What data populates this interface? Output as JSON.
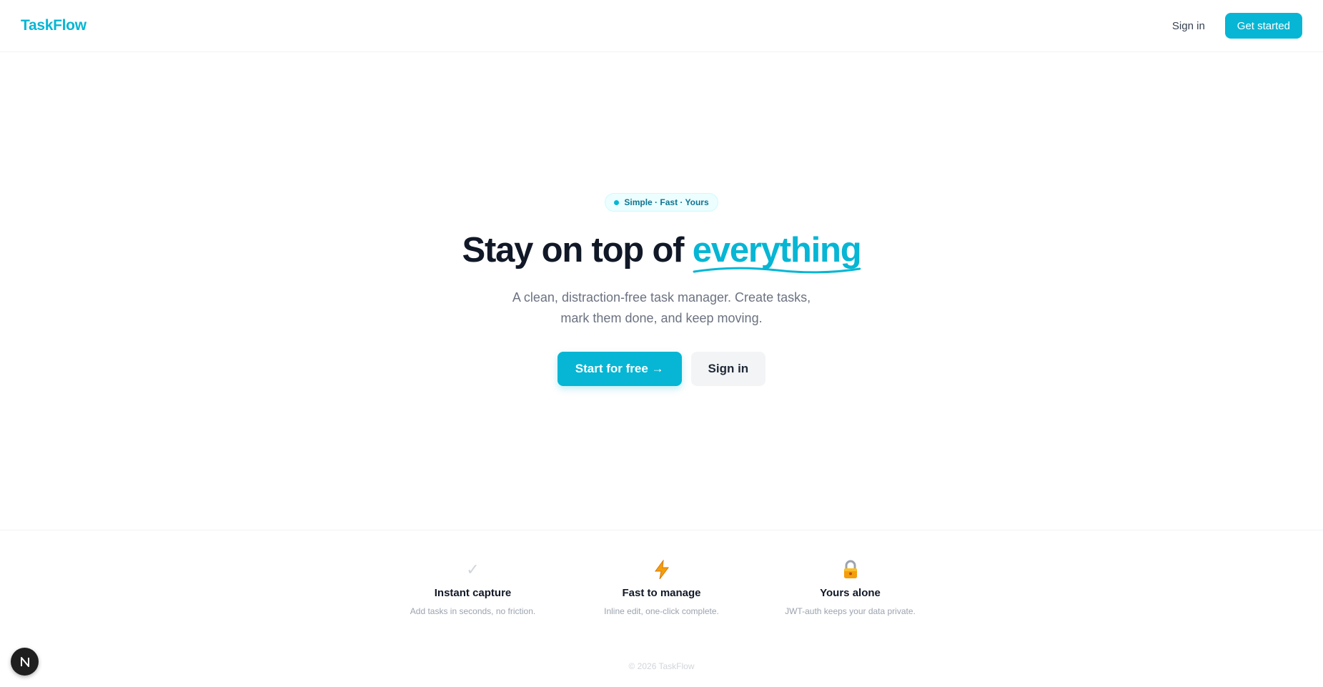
{
  "header": {
    "logo": "TaskFlow",
    "signin_label": "Sign in",
    "cta_label": "Get started"
  },
  "hero": {
    "badge": "Simple · Fast · Yours",
    "headline_prefix": "Stay on top of ",
    "headline_accent": "everything",
    "subtitle": "A clean, distraction-free task manager. Create tasks, mark them done, and keep moving.",
    "primary_label": "Start for free →",
    "secondary_label": "Sign in"
  },
  "features": [
    {
      "icon": "check-icon",
      "title": "Instant capture",
      "desc": "Add tasks in seconds, no friction."
    },
    {
      "icon": "lightning-icon",
      "title": "Fast to manage",
      "desc": "Inline edit, one-click complete."
    },
    {
      "icon": "lock-icon",
      "title": "Yours alone",
      "desc": "JWT-auth keeps your data private."
    }
  ],
  "footer": {
    "copyright": "© 2026 TaskFlow"
  },
  "floating_badge": {
    "icon": "nextjs-n-icon"
  },
  "colors": {
    "accent": "#06b6d4",
    "text": "#111827",
    "muted": "#6b7280"
  }
}
